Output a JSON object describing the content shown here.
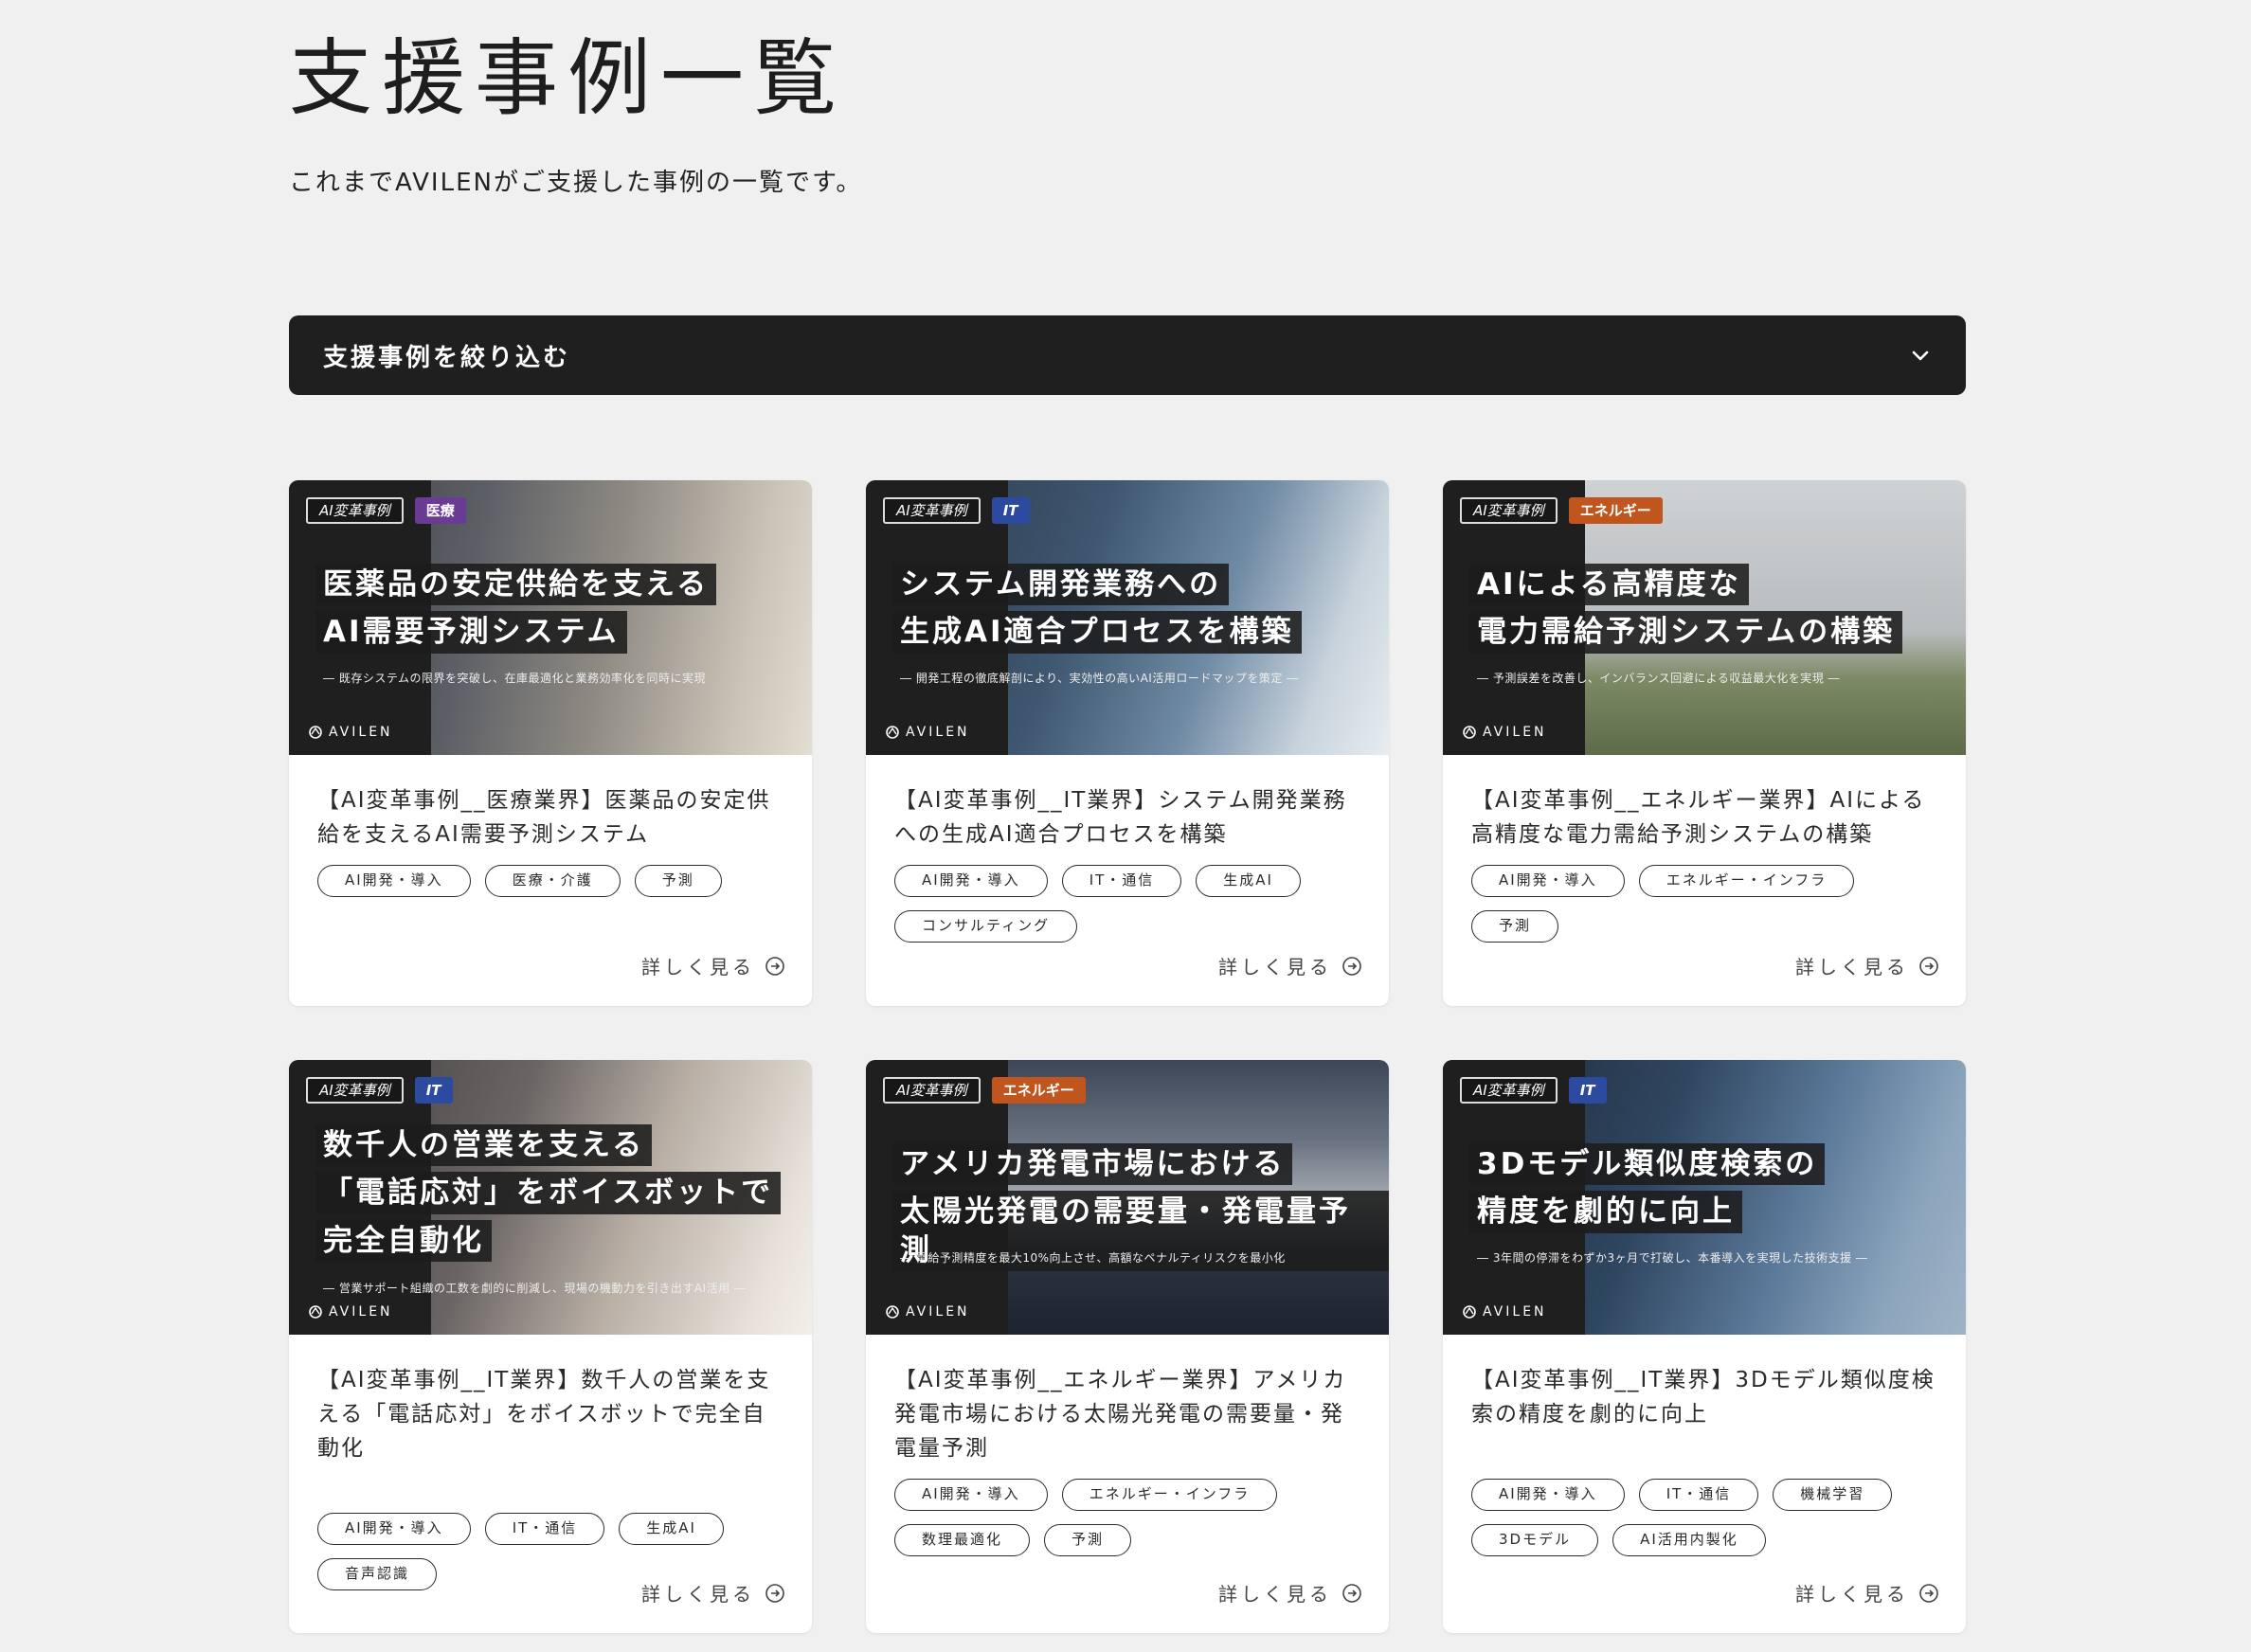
{
  "page": {
    "title": "支援事例一覧",
    "lead": "これまでAVILENがご支援した事例の一覧です。"
  },
  "filter": {
    "label": "支援事例を絞り込む",
    "icon": "chevron-down-icon"
  },
  "colors": {
    "dark": "#1f1f1f",
    "medical": "#6a3b95",
    "it": "#2b4aa0",
    "energy": "#c0561e"
  },
  "cards": [
    {
      "badge_category": "AI変革事例",
      "badge_industry": "医療",
      "badge_color": "#6a3b95",
      "headline": [
        "医薬品の安定供給を支える",
        "AI需要予測システム"
      ],
      "subline": "― 既存システムの限界を突破し、在庫最適化と業務効率化を同時に実現",
      "brand": "AVILEN",
      "title": "【AI変革事例__医療業界】医薬品の安定供給を支えるAI需要予測システム",
      "tags": [
        "AI開発・導入",
        "医療・介護",
        "予測"
      ],
      "more": "詳しく見る"
    },
    {
      "badge_category": "AI変革事例",
      "badge_industry": "IT",
      "badge_color": "#2b4aa0",
      "headline": [
        "システム開発業務への",
        "生成AI適合プロセスを構築"
      ],
      "subline": "― 開発工程の徹底解剖により、実効性の高いAI活用ロードマップを策定 ―",
      "brand": "AVILEN",
      "title": "【AI変革事例__IT業界】システム開発業務への生成AI適合プロセスを構築",
      "tags": [
        "AI開発・導入",
        "IT・通信",
        "生成AI",
        "コンサルティング"
      ],
      "more": "詳しく見る"
    },
    {
      "badge_category": "AI変革事例",
      "badge_industry": "エネルギー",
      "badge_color": "#c0561e",
      "headline": [
        "AIによる高精度な",
        "電力需給予測システムの構築"
      ],
      "subline": "― 予測誤差を改善し、インバランス回避による収益最大化を実現 ―",
      "brand": "AVILEN",
      "title": "【AI変革事例__エネルギー業界】AIによる高精度な電力需給予測システムの構築",
      "tags": [
        "AI開発・導入",
        "エネルギー・インフラ",
        "予測"
      ],
      "more": "詳しく見る"
    },
    {
      "badge_category": "AI変革事例",
      "badge_industry": "IT",
      "badge_color": "#2b4aa0",
      "headline": [
        "数千人の営業を支える",
        "「電話応対」をボイスボットで",
        "完全自動化"
      ],
      "subline": "― 営業サポート組織の工数を劇的に削減し、現場の機動力を引き出すAI活用 ―",
      "brand": "AVILEN",
      "title": "【AI変革事例__IT業界】数千人の営業を支える「電話応対」をボイスボットで完全自動化",
      "tags": [
        "AI開発・導入",
        "IT・通信",
        "生成AI",
        "音声認識"
      ],
      "more": "詳しく見る"
    },
    {
      "badge_category": "AI変革事例",
      "badge_industry": "エネルギー",
      "badge_color": "#c0561e",
      "headline": [
        "アメリカ発電市場における",
        "太陽光発電の需要量・発電量予測"
      ],
      "subline": "― 需給予測精度を最大10%向上させ、高額なペナルティリスクを最小化",
      "brand": "AVILEN",
      "title": "【AI変革事例__エネルギー業界】アメリカ発電市場における太陽光発電の需要量・発電量予測",
      "tags": [
        "AI開発・導入",
        "エネルギー・インフラ",
        "数理最適化",
        "予測"
      ],
      "more": "詳しく見る"
    },
    {
      "badge_category": "AI変革事例",
      "badge_industry": "IT",
      "badge_color": "#2b4aa0",
      "headline": [
        "3Dモデル類似度検索の",
        "精度を劇的に向上"
      ],
      "subline": "― 3年間の停滞をわずか3ヶ月で打破し、本番導入を実現した技術支援 ―",
      "brand": "AVILEN",
      "title": "【AI変革事例__IT業界】3Dモデル類似度検索の精度を劇的に向上",
      "tags": [
        "AI開発・導入",
        "IT・通信",
        "機械学習",
        "3Dモデル",
        "AI活用内製化"
      ],
      "more": "詳しく見る"
    }
  ]
}
